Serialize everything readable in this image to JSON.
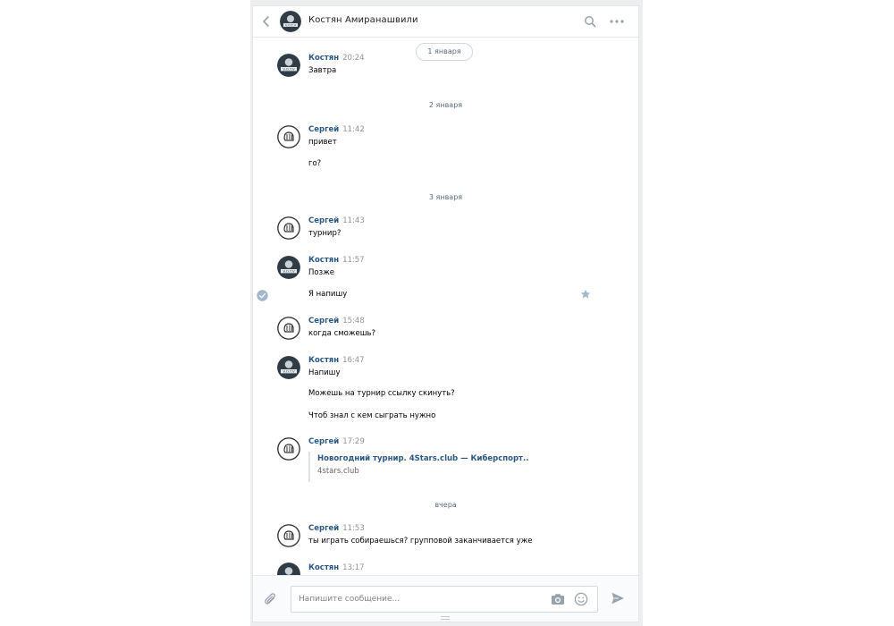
{
  "header": {
    "title": "Костян Амиранашвили",
    "back_icon": "chevron-left-icon",
    "search_icon": "search-icon",
    "more_icon": "more-dots-icon"
  },
  "history": {
    "date_jan1": "1 января",
    "date_jan2": "2 января",
    "date_jan3": "3 января",
    "date_yesterday": "вчера",
    "messages": [
      {
        "author": "Костян",
        "time": "20:24",
        "lines": [
          "Завтра"
        ]
      },
      {
        "author": "Сергей",
        "time": "11:42",
        "lines": [
          "привет",
          "го?"
        ]
      },
      {
        "author": "Сергей",
        "time": "11:43",
        "lines": [
          "турнир?"
        ]
      },
      {
        "author": "Костян",
        "time": "11:57",
        "lines": [
          "Позже",
          "Я напишу"
        ]
      },
      {
        "author": "Сергей",
        "time": "15:48",
        "lines": [
          "когда сможешь?"
        ]
      },
      {
        "author": "Костян",
        "time": "16:47",
        "lines": [
          "Напишу",
          "Можешь на турнир ссылку скинуть?",
          "Чтоб знал с кем сыграть нужно"
        ]
      },
      {
        "author": "Сергей",
        "time": "17:29",
        "lines": []
      },
      {
        "author": "Сергей",
        "time": "11:53",
        "lines": [
          "ты играть собираешься? групповой заканчивается уже"
        ]
      },
      {
        "author": "Костян",
        "time": "13:17",
        "lines": []
      }
    ],
    "link": {
      "title": "Новогодний турнир. 4Stars.club — Киберспорт..",
      "domain": "4stars.club"
    }
  },
  "composer": {
    "placeholder": "Напишите сообщение...",
    "value": ""
  },
  "colors": {
    "accent": "#2a5885",
    "icon": "#99a2ad",
    "background": "#edeef0",
    "read_check": "#a3b6cb"
  }
}
